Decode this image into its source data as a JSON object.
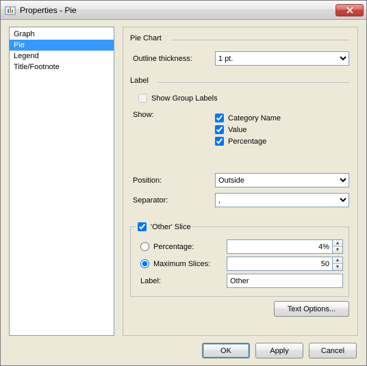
{
  "window": {
    "title": "Properties - Pie"
  },
  "nav": {
    "items": [
      {
        "label": "Graph"
      },
      {
        "label": "Pie"
      },
      {
        "label": "Legend"
      },
      {
        "label": "Title/Footnote"
      }
    ],
    "selected_index": 1
  },
  "pie_chart": {
    "legend": "Pie Chart",
    "outline_thickness_label": "Outline thickness:",
    "outline_thickness_value": "1 pt."
  },
  "label_section": {
    "legend": "Label",
    "show_group_labels": "Show Group Labels",
    "show_label": "Show:",
    "category_name": "Category Name",
    "value": "Value",
    "percentage": "Percentage",
    "category_name_checked": true,
    "value_checked": true,
    "percentage_checked": true,
    "position_label": "Position:",
    "position_value": "Outside",
    "separator_label": "Separator:",
    "separator_value": ","
  },
  "other_slice": {
    "legend": "'Other' Slice",
    "enabled": true,
    "percentage_label": "Percentage:",
    "percentage_value": "4%",
    "max_slices_label": "Maximum Slices:",
    "max_slices_value": "50",
    "mode": "max_slices",
    "label_label": "Label:",
    "label_value": "Other"
  },
  "buttons": {
    "text_options": "Text Options...",
    "ok": "OK",
    "apply": "Apply",
    "cancel": "Cancel"
  }
}
